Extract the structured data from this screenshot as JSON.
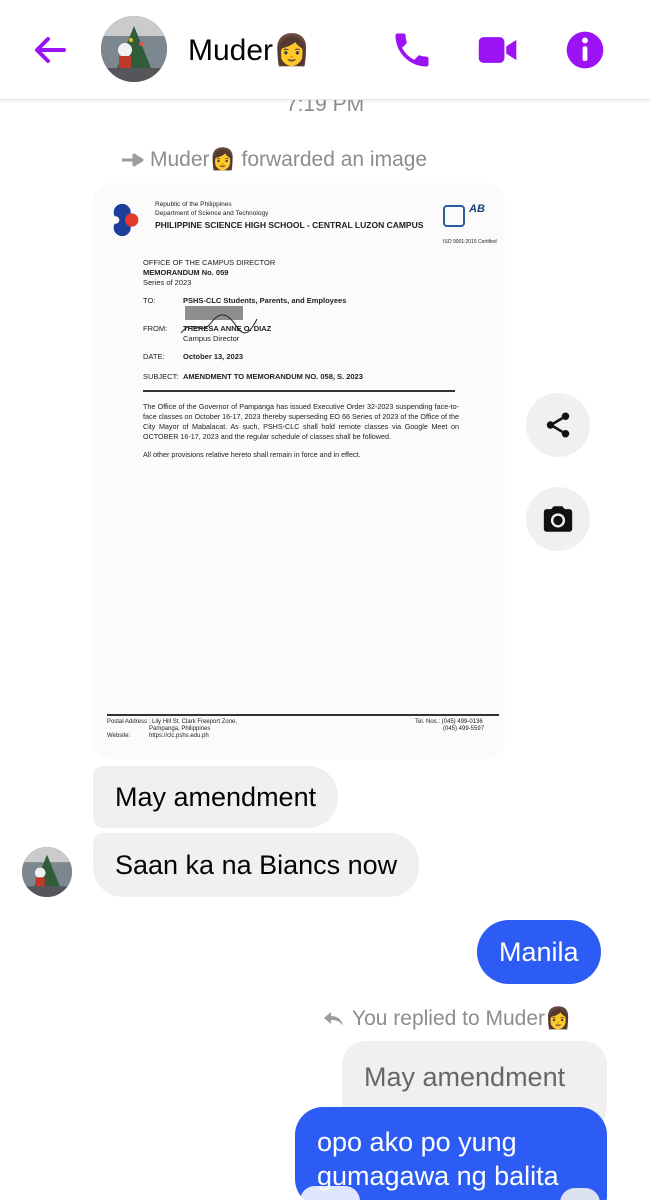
{
  "colors": {
    "accent": "#9b12f5",
    "outgoing_bubble": "#2d5cf5",
    "incoming_bubble": "#f0f0f0",
    "muted_text": "#8a8d91"
  },
  "header": {
    "back_icon": "arrow-left-icon",
    "contact_name": "Muder👩",
    "call_icon": "phone-icon",
    "video_icon": "video-camera-icon",
    "info_icon": "info-icon"
  },
  "thread": {
    "timestamp": "7:19 PM",
    "forwarded_note": "Muder👩 forwarded an image",
    "memo": {
      "republic": "Republic of the Philippines",
      "department": "Department of Science and Technology",
      "school": "PHILIPPINE SCIENCE HIGH SCHOOL - CENTRAL LUZON CAMPUS",
      "iso": "ISO 9001:2015 Certified",
      "office": "OFFICE OF THE CAMPUS DIRECTOR",
      "memo_no": "MEMORANDUM No. 059",
      "series": "Series of 2023",
      "to_label": "TO:",
      "to_value": "PSHS-CLC Students, Parents, and Employees",
      "from_label": "FROM:",
      "from_value": "THERESA ANNE O. DIAZ",
      "from_title": "Campus Director",
      "date_label": "DATE:",
      "date_value": "October 13, 2023",
      "subject_label": "SUBJECT:",
      "subject_value": "AMENDMENT TO MEMORANDUM NO. 058, S. 2023",
      "body_1": "The Office of the Governor of Pampanga has issued Executive Order 32-2023 suspending face-to-face classes on October 16-17, 2023 thereby superseding EO 66 Series of 2023 of the Office of the City Mayor of Mabalacat. As such, PSHS-CLC shall hold remote classes via Google Meet on OCTOBER 16-17, 2023 and the regular schedule of classes shall be followed.",
      "body_2": "All other provisions relative hereto shall remain in force and in effect.",
      "postal_label": "Postal Address :",
      "postal_1": "Lily Hill St. Clark Freeport Zone,",
      "postal_2": "Pampanga, Philippines",
      "website_label": "Website:",
      "website": "https://clc.pshs.edu.ph",
      "tel_1": "Tel. Nos.: (045) 499-0136",
      "tel_2": "(045) 499-5597"
    },
    "share_icon": "share-icon",
    "camera_icon": "camera-icon",
    "messages": [
      {
        "from": "Muder",
        "text": "May amendment"
      },
      {
        "from": "Muder",
        "text": "Saan ka na Biancs now"
      },
      {
        "from": "me",
        "text": "Manila"
      }
    ],
    "reply_note": "You replied to Muder👩",
    "quoted_text": "May amendment",
    "last_message": "opo ako po yung gumagawa ng balita"
  }
}
